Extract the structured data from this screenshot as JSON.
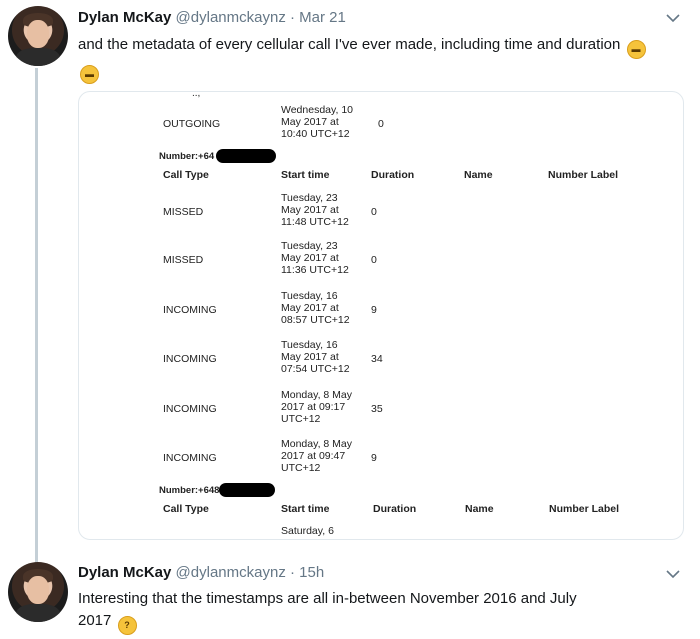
{
  "tweet1": {
    "name": "Dylan McKay",
    "handle": "@dylanmckaynz",
    "separator": "·",
    "time": "Mar 21",
    "text": "and the metadata of every cellular call I've ever made, including time and duration",
    "emoji": "grimacing-face-emoji",
    "caret_icon": "chevron-down-icon"
  },
  "media": {
    "cut_top": "..,",
    "top_row": {
      "type": "OUTGOING",
      "start_lines": [
        "Wednesday, 10",
        "May 2017 at",
        "10:40 UTC+12"
      ],
      "duration": "0"
    },
    "number_prefix_1": "Number:+64",
    "headers": {
      "call_type": "Call Type",
      "start_time": "Start time",
      "duration": "Duration",
      "name": "Name",
      "number_label": "Number Label"
    },
    "rows": [
      {
        "type": "MISSED",
        "start_lines": [
          "Tuesday, 23",
          "May 2017 at",
          "11:48 UTC+12"
        ],
        "duration": "0"
      },
      {
        "type": "MISSED",
        "start_lines": [
          "Tuesday, 23",
          "May 2017 at",
          "11:36 UTC+12"
        ],
        "duration": "0"
      },
      {
        "type": "INCOMING",
        "start_lines": [
          "Tuesday, 16",
          "May 2017 at",
          "08:57 UTC+12"
        ],
        "duration": "9"
      },
      {
        "type": "INCOMING",
        "start_lines": [
          "Tuesday, 16",
          "May 2017 at",
          "07:54 UTC+12"
        ],
        "duration": "34"
      },
      {
        "type": "INCOMING",
        "start_lines": [
          "Monday, 8 May",
          "2017 at 09:17",
          "UTC+12"
        ],
        "duration": "35"
      },
      {
        "type": "INCOMING",
        "start_lines": [
          "Monday, 8 May",
          "2017 at 09:47",
          "UTC+12"
        ],
        "duration": "9"
      }
    ],
    "number_prefix_2": "Number:+648",
    "bottom_start": "Saturday, 6"
  },
  "tweet2": {
    "name": "Dylan McKay",
    "handle": "@dylanmckaynz",
    "separator": "·",
    "time": "15h",
    "text_line1": "Interesting that the timestamps are all in-between November 2016 and July",
    "text_line2": "2017",
    "emoji": "thinking-face-emoji",
    "caret_icon": "chevron-down-icon"
  },
  "colors": {
    "thread_line": "#c4cfd6",
    "secondary_text": "#657786",
    "border": "#e1e8ed"
  }
}
